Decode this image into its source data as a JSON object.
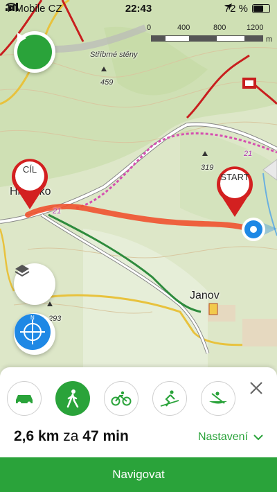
{
  "status_bar": {
    "carrier": "T-Mobile CZ",
    "time": "22:43",
    "battery": "72 %",
    "battery_level": 0.72
  },
  "map": {
    "scale_labels": [
      "0",
      "400",
      "800",
      "1200"
    ],
    "scale_unit": "m",
    "labels": {
      "stribrne_steny": "Stříbrné stěny",
      "elev_459": "459",
      "elev_319": "319",
      "elev_293": "293",
      "route_21a": "21",
      "route_21b": "21",
      "village_janov": "Janov",
      "village_west": "Hřensko"
    },
    "pins": {
      "start": "START",
      "finish": "CÍL"
    },
    "colors": {
      "route": "#f0522f",
      "trail_red": "#c81e1e",
      "trail_green": "#2e8b3d",
      "accent": "#2aa33a"
    },
    "icons": {
      "play": "play-icon",
      "layers": "layers-icon",
      "compass": "compass-icon"
    }
  },
  "panel": {
    "modes": [
      {
        "name": "car",
        "icon": "car-icon",
        "active": false
      },
      {
        "name": "walk",
        "icon": "walk-icon",
        "active": true
      },
      {
        "name": "bike",
        "icon": "bike-icon",
        "active": false
      },
      {
        "name": "ski",
        "icon": "ski-icon",
        "active": false
      },
      {
        "name": "canoe",
        "icon": "canoe-icon",
        "active": false
      }
    ],
    "distance": "2,6 km",
    "za": "za",
    "duration": "47 min",
    "settings_label": "Nastavení",
    "navigate_label": "Navigovat"
  }
}
